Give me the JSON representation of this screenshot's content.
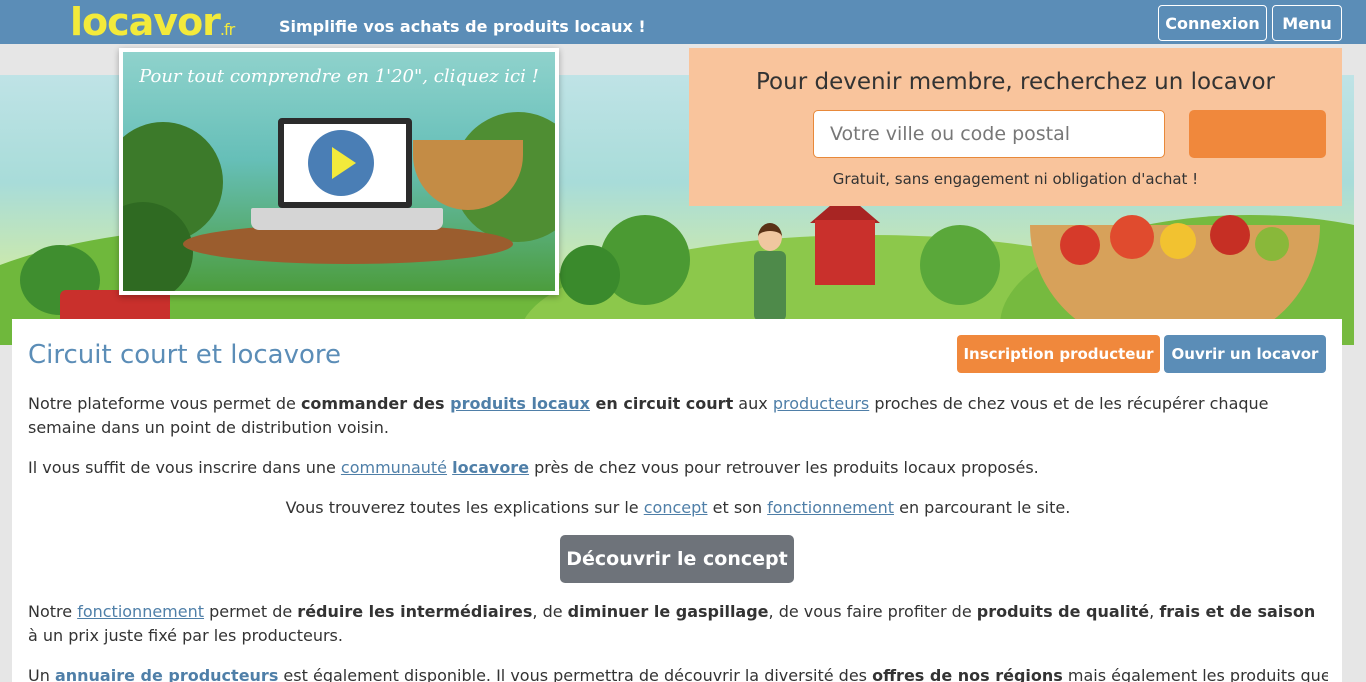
{
  "header": {
    "logo_text": "locavor",
    "logo_tld": ".fr",
    "tagline": "Simplifie vos achats de produits locaux !",
    "login_label": "Connexion",
    "menu_label": "Menu"
  },
  "video": {
    "caption": "Pour tout comprendre en 1'20\", cliquez ici !"
  },
  "search": {
    "title": "Pour devenir membre, recherchez un locavor",
    "placeholder": "Votre ville ou code postal",
    "note": "Gratuit, sans engagement ni obligation d'achat !"
  },
  "main": {
    "title": "Circuit court et locavore",
    "producer_button": "Inscription producteur",
    "open_button": "Ouvrir un locavor",
    "p1": {
      "t1": "Notre plateforme vous permet de ",
      "b1": "commander des ",
      "l1": "produits locaux",
      "b2": " en circuit court",
      "t2": " aux ",
      "l2": "producteurs",
      "t3": " proches de chez vous et de les récupérer chaque semaine dans un point de distribution voisin."
    },
    "p2": {
      "t1": "Il vous suffit de vous inscrire dans une ",
      "l1": "communauté",
      "t2": " ",
      "l2": "locavore",
      "t3": " près de chez vous pour retrouver les produits locaux proposés."
    },
    "p3": {
      "t1": "Vous trouverez toutes les explications sur le ",
      "l1": "concept",
      "t2": " et son ",
      "l2": "fonctionnement",
      "t3": " en parcourant le site."
    },
    "concept_button": "Découvrir le concept",
    "p4": {
      "t1": "Notre ",
      "l1": "fonctionnement",
      "t2": " permet de ",
      "b1": "réduire les intermédiaires",
      "t3": ", de ",
      "b2": "diminuer le gaspillage",
      "t4": ", de vous faire profiter de ",
      "b3": "produits de qualité",
      "t5": ", ",
      "b4": "frais et de saison",
      "t6": " à un prix juste fixé par les producteurs."
    },
    "p5": {
      "t1": "Un ",
      "l1": "annuaire de producteurs",
      "t2": " est également disponible. Il vous permettra de découvrir la diversité des ",
      "b1": "offres de nos régions",
      "t3": " mais également les produits que les points de"
    }
  },
  "colors": {
    "header_blue": "#5b8db7",
    "accent_orange": "#f0883c",
    "panel_peach": "#f9c49c",
    "logo_yellow": "#f3ea3b"
  }
}
